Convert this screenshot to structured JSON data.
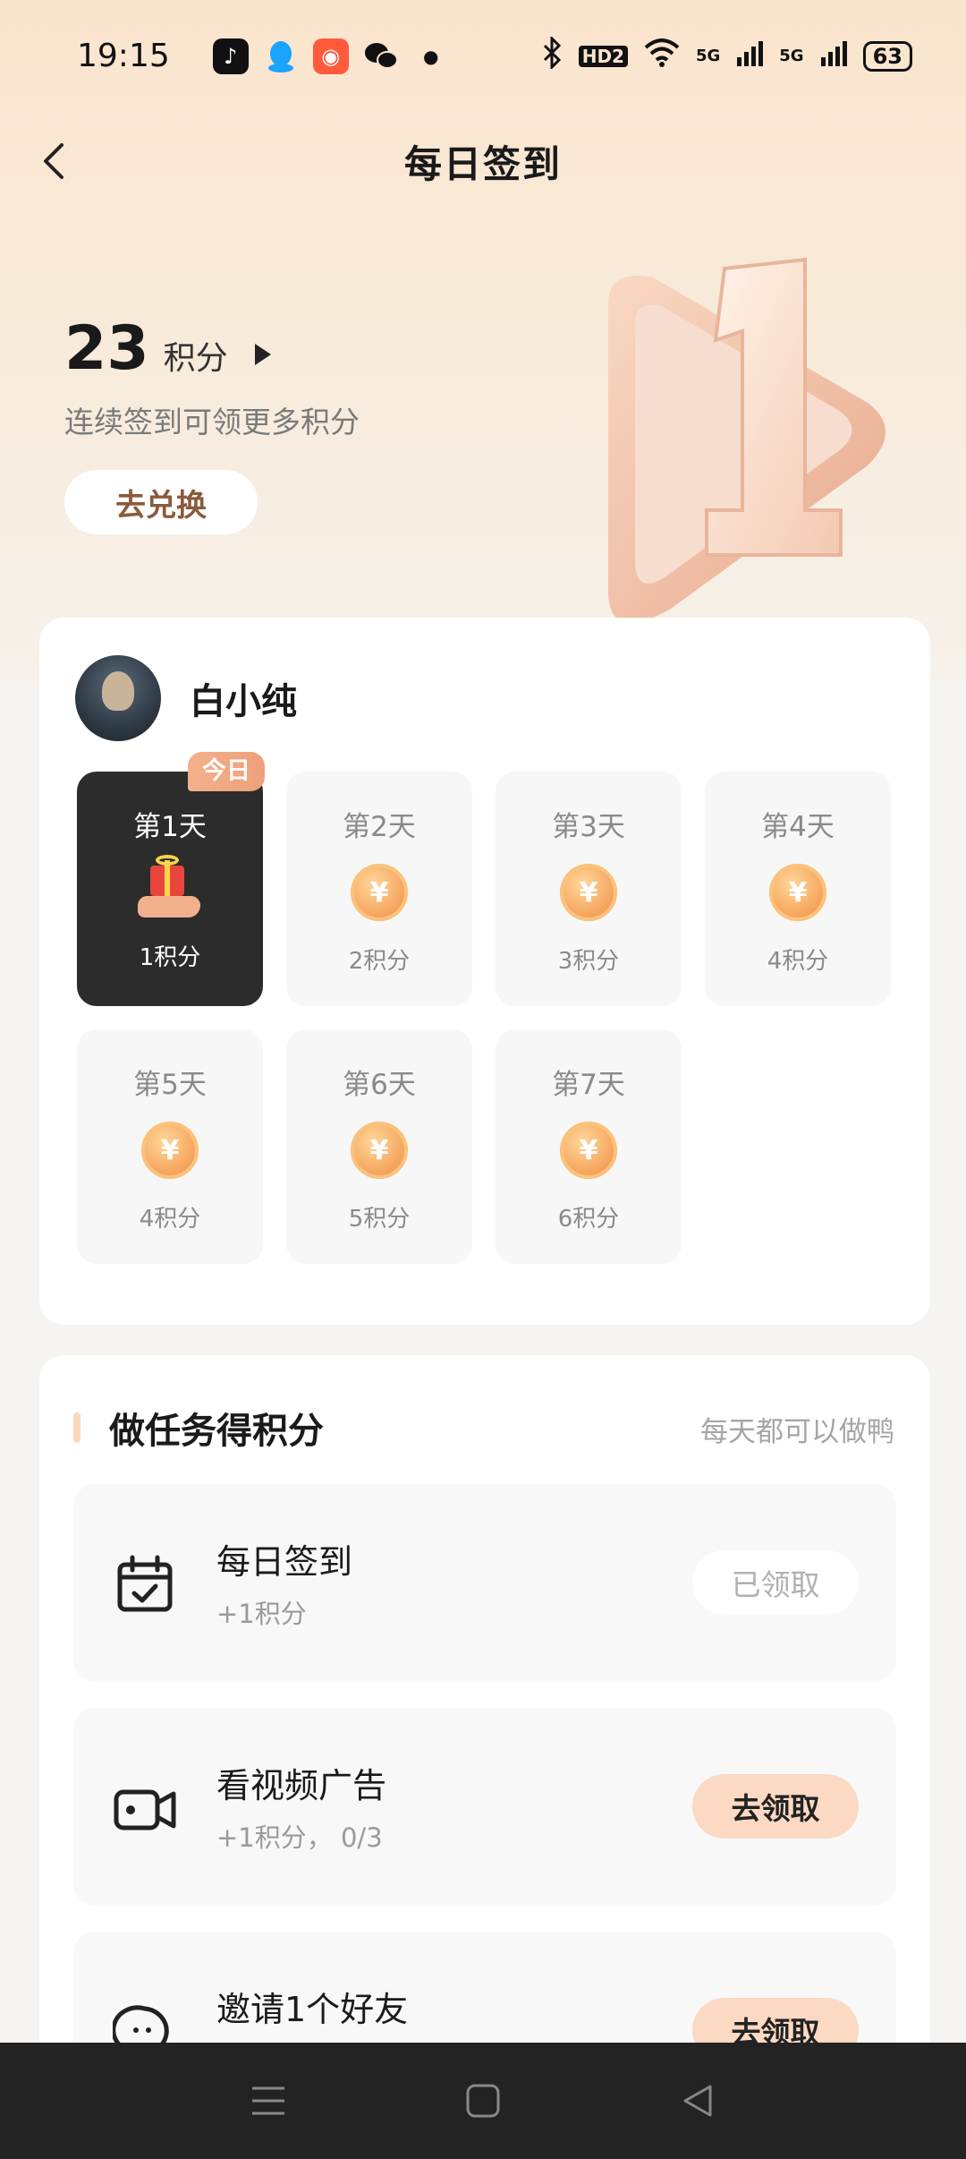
{
  "status_bar": {
    "time": "19:15",
    "battery": "63",
    "signal_labels": [
      "HD2",
      "5G",
      "5G"
    ],
    "icons": [
      "tiktok-icon",
      "qq-icon",
      "app-icon",
      "wechat-icon",
      "dot-icon",
      "bluetooth-icon",
      "wifi-icon",
      "signal-icon",
      "battery-icon"
    ]
  },
  "header": {
    "title": "每日签到",
    "back_icon": "chevron-left-icon"
  },
  "points": {
    "value": "23",
    "unit": "积分",
    "subtitle": "连续签到可领更多积分",
    "exchange_label": "去兑换",
    "decoration_digit": "1"
  },
  "user": {
    "name": "白小纯"
  },
  "checkin": {
    "today_badge": "今日",
    "days": [
      {
        "label": "第1天",
        "points": "1积分",
        "today": true
      },
      {
        "label": "第2天",
        "points": "2积分",
        "today": false
      },
      {
        "label": "第3天",
        "points": "3积分",
        "today": false
      },
      {
        "label": "第4天",
        "points": "4积分",
        "today": false
      },
      {
        "label": "第5天",
        "points": "4积分",
        "today": false
      },
      {
        "label": "第6天",
        "points": "5积分",
        "today": false
      },
      {
        "label": "第7天",
        "points": "6积分",
        "today": false
      }
    ],
    "coin_symbol": "¥"
  },
  "tasks": {
    "title": "做任务得积分",
    "hint": "每天都可以做鸭",
    "items": [
      {
        "name": "每日签到",
        "reward": "+1积分",
        "button": "已领取",
        "state": "done",
        "icon": "calendar-check-icon"
      },
      {
        "name": "看视频广告",
        "reward": "+1积分， 0/3",
        "button": "去领取",
        "state": "go",
        "icon": "video-camera-icon"
      },
      {
        "name": "邀请1个好友",
        "reward": "",
        "button": "去领取",
        "state": "go",
        "icon": "chat-user-icon"
      }
    ]
  },
  "nav": {
    "icons": [
      "menu-icon",
      "home-square-icon",
      "back-triangle-icon"
    ]
  },
  "colors": {
    "accent": "#fbd9c2",
    "today_bg": "#2c2c2c",
    "badge": "#eea07b",
    "coin": "#f6a760"
  }
}
